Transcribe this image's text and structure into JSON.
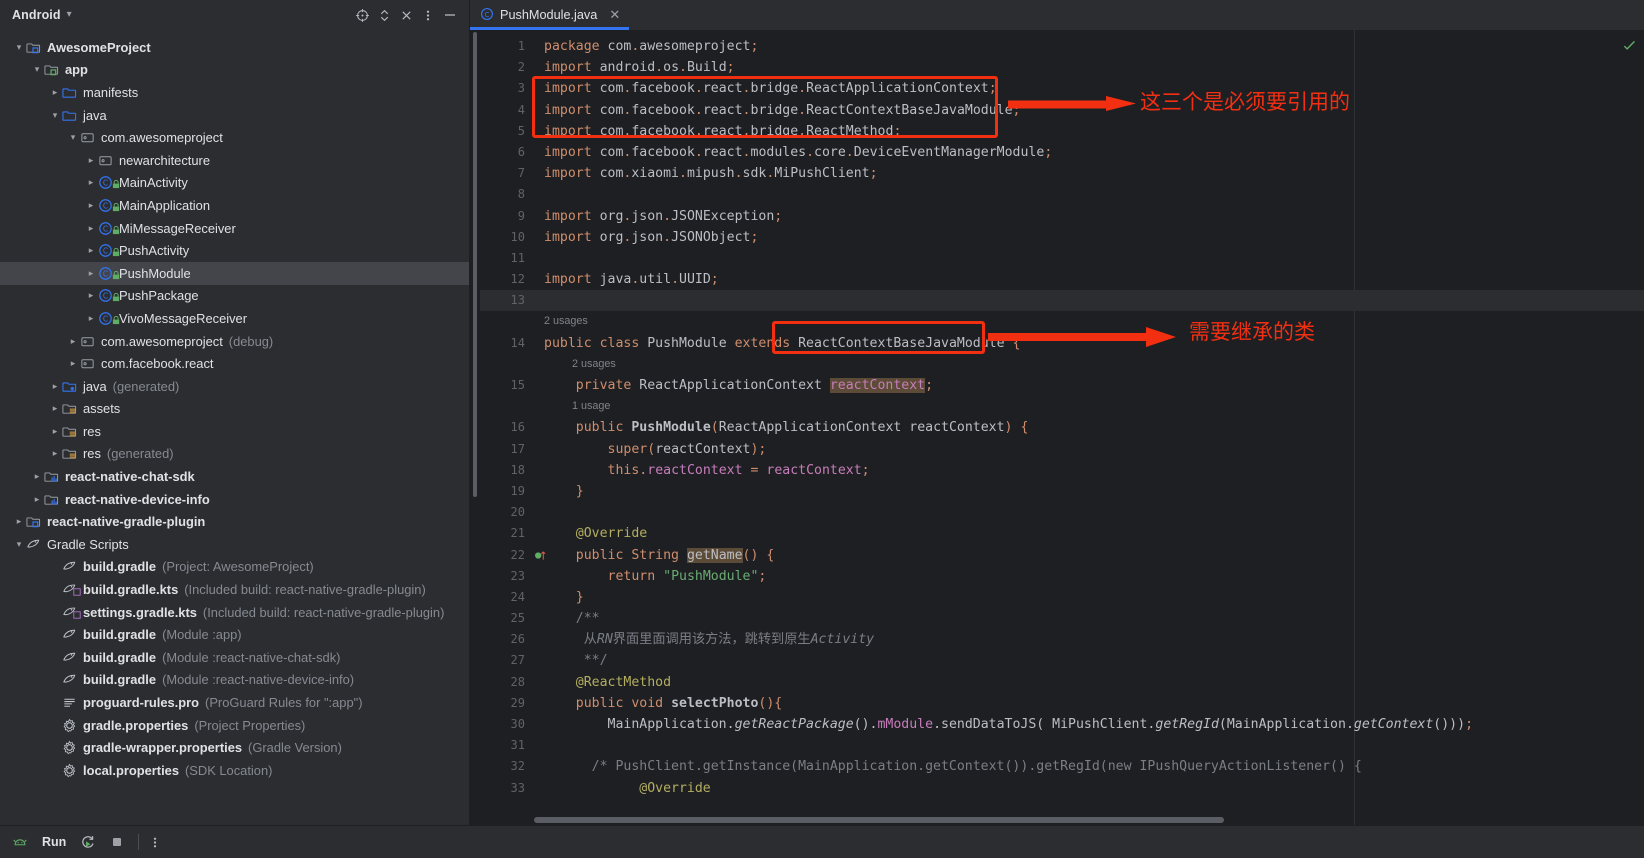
{
  "window": {
    "left_panel_title": "Android",
    "toolbar_icons": [
      "target-icon",
      "expand-collapse-icon",
      "close-icon",
      "more-options-icon",
      "minimize-icon"
    ]
  },
  "tree": [
    {
      "indent": 0,
      "arrow": "down",
      "icon": "module-folder-icon",
      "label": "AwesomeProject",
      "bold": true,
      "sub": ""
    },
    {
      "indent": 1,
      "arrow": "down",
      "icon": "module-folder-green-icon",
      "label": "app",
      "bold": true,
      "sub": ""
    },
    {
      "indent": 2,
      "arrow": "right",
      "icon": "folder-icon",
      "label": "manifests",
      "bold": false,
      "sub": ""
    },
    {
      "indent": 2,
      "arrow": "down",
      "icon": "folder-icon",
      "label": "java",
      "bold": false,
      "sub": ""
    },
    {
      "indent": 3,
      "arrow": "down",
      "icon": "package-icon",
      "label": "com.awesomeproject",
      "bold": false,
      "sub": ""
    },
    {
      "indent": 4,
      "arrow": "right",
      "icon": "package-icon",
      "label": "newarchitecture",
      "bold": false,
      "sub": ""
    },
    {
      "indent": 4,
      "arrow": "right",
      "icon": "java-class-icon",
      "label": "MainActivity",
      "bold": false,
      "sub": ""
    },
    {
      "indent": 4,
      "arrow": "right",
      "icon": "java-class-icon",
      "label": "MainApplication",
      "bold": false,
      "sub": ""
    },
    {
      "indent": 4,
      "arrow": "right",
      "icon": "java-class-icon",
      "label": "MiMessageReceiver",
      "bold": false,
      "sub": ""
    },
    {
      "indent": 4,
      "arrow": "right",
      "icon": "java-class-icon",
      "label": "PushActivity",
      "bold": false,
      "sub": ""
    },
    {
      "indent": 4,
      "arrow": "right",
      "icon": "java-class-icon",
      "label": "PushModule",
      "bold": false,
      "sub": "",
      "selected": true
    },
    {
      "indent": 4,
      "arrow": "right",
      "icon": "java-class-icon",
      "label": "PushPackage",
      "bold": false,
      "sub": ""
    },
    {
      "indent": 4,
      "arrow": "right",
      "icon": "java-class-icon",
      "label": "VivoMessageReceiver",
      "bold": false,
      "sub": ""
    },
    {
      "indent": 3,
      "arrow": "right",
      "icon": "package-icon",
      "label": "com.awesomeproject",
      "bold": false,
      "sub": "(debug)"
    },
    {
      "indent": 3,
      "arrow": "right",
      "icon": "package-icon",
      "label": "com.facebook.react",
      "bold": false,
      "sub": ""
    },
    {
      "indent": 2,
      "arrow": "right",
      "icon": "generated-folder-icon",
      "label": "java",
      "bold": false,
      "sub": "(generated)"
    },
    {
      "indent": 2,
      "arrow": "right",
      "icon": "assets-folder-icon",
      "label": "assets",
      "bold": false,
      "sub": ""
    },
    {
      "indent": 2,
      "arrow": "right",
      "icon": "res-folder-icon",
      "label": "res",
      "bold": false,
      "sub": ""
    },
    {
      "indent": 2,
      "arrow": "right",
      "icon": "res-folder-icon",
      "label": "res",
      "bold": false,
      "sub": "(generated)"
    },
    {
      "indent": 1,
      "arrow": "right",
      "icon": "library-module-icon",
      "label": "react-native-chat-sdk",
      "bold": true,
      "sub": ""
    },
    {
      "indent": 1,
      "arrow": "right",
      "icon": "library-module-icon",
      "label": "react-native-device-info",
      "bold": true,
      "sub": ""
    },
    {
      "indent": 0,
      "arrow": "right",
      "icon": "module-folder-icon",
      "label": "react-native-gradle-plugin",
      "bold": true,
      "sub": ""
    },
    {
      "indent": 0,
      "arrow": "down",
      "icon": "gradle-icon",
      "label": "Gradle Scripts",
      "bold": false,
      "sub": ""
    },
    {
      "indent": 2,
      "arrow": "none",
      "icon": "gradle-file-icon",
      "label": "build.gradle",
      "bold": true,
      "sub": "(Project: AwesomeProject)"
    },
    {
      "indent": 2,
      "arrow": "none",
      "icon": "gradle-kts-file-icon",
      "label": "build.gradle.kts",
      "bold": true,
      "sub": "(Included build: react-native-gradle-plugin)"
    },
    {
      "indent": 2,
      "arrow": "none",
      "icon": "gradle-kts-file-icon",
      "label": "settings.gradle.kts",
      "bold": true,
      "sub": "(Included build: react-native-gradle-plugin)"
    },
    {
      "indent": 2,
      "arrow": "none",
      "icon": "gradle-file-icon",
      "label": "build.gradle",
      "bold": true,
      "sub": "(Module :app)"
    },
    {
      "indent": 2,
      "arrow": "none",
      "icon": "gradle-file-icon",
      "label": "build.gradle",
      "bold": true,
      "sub": "(Module :react-native-chat-sdk)"
    },
    {
      "indent": 2,
      "arrow": "none",
      "icon": "gradle-file-icon",
      "label": "build.gradle",
      "bold": true,
      "sub": "(Module :react-native-device-info)"
    },
    {
      "indent": 2,
      "arrow": "none",
      "icon": "text-file-icon",
      "label": "proguard-rules.pro",
      "bold": true,
      "sub": "(ProGuard Rules for \":app\")"
    },
    {
      "indent": 2,
      "arrow": "none",
      "icon": "properties-file-icon",
      "label": "gradle.properties",
      "bold": true,
      "sub": "(Project Properties)"
    },
    {
      "indent": 2,
      "arrow": "none",
      "icon": "properties-file-icon",
      "label": "gradle-wrapper.properties",
      "bold": true,
      "sub": "(Gradle Version)"
    },
    {
      "indent": 2,
      "arrow": "none",
      "icon": "properties-file-icon",
      "label": "local.properties",
      "bold": true,
      "sub": "(SDK Location)"
    }
  ],
  "editor": {
    "tab_label": "PushModule.java",
    "tab_icon": "java-class-icon",
    "tab_close_icon": "close-icon",
    "inspections_icon": "inspections-ok-icon",
    "line_numbers": [
      "1",
      "2",
      "3",
      "4",
      "5",
      "6",
      "7",
      "8",
      "9",
      "10",
      "11",
      "12",
      "13",
      "14",
      "15",
      "16",
      "17",
      "18",
      "19",
      "20",
      "21",
      "22",
      "23",
      "24",
      "25",
      "26",
      "27",
      "28",
      "29",
      "30",
      "31",
      "32",
      "33"
    ],
    "current_line": 13,
    "gutter_marker_line": 22,
    "gutter_marker_icon": "override-method-icon",
    "inlay_hints": [
      {
        "before_line": 14,
        "text": "2 usages",
        "indent": 0
      },
      {
        "before_line": 15,
        "text": "2 usages",
        "indent": 1
      },
      {
        "before_line": 16,
        "text": "1 usage",
        "indent": 1
      }
    ],
    "lines": [
      "package com.awesomeproject;",
      "import android.os.Build;",
      "import com.facebook.react.bridge.ReactApplicationContext;",
      "import com.facebook.react.bridge.ReactContextBaseJavaModule;",
      "import com.facebook.react.bridge.ReactMethod;",
      "import com.facebook.react.modules.core.DeviceEventManagerModule;",
      "import com.xiaomi.mipush.sdk.MiPushClient;",
      "",
      "import org.json.JSONException;",
      "import org.json.JSONObject;",
      "",
      "import java.util.UUID;",
      "",
      "public class PushModule extends ReactContextBaseJavaModule {",
      "    private ReactApplicationContext reactContext;",
      "    public PushModule(ReactApplicationContext reactContext) {",
      "        super(reactContext);",
      "        this.reactContext = reactContext;",
      "    }",
      "",
      "    @Override",
      "    public String getName() {",
      "        return \"PushModule\";",
      "    }",
      "    /**",
      "     从RN界面里面调用该方法，跳转到原生Activity",
      "     **/",
      "    @ReactMethod",
      "    public void selectPhoto(){",
      "        MainApplication.getReactPackage().mModule.sendDataToJS( MiPushClient.getRegId(MainApplication.getContext()));",
      "",
      "      /* PushClient.getInstance(MainApplication.getContext()).getRegId(new IPushQueryActionListener() {",
      "            @Override"
    ]
  },
  "annotations": [
    {
      "name": "imports-highlight-box",
      "text": "这三个是必须要引用的",
      "color": "#f32f12"
    },
    {
      "name": "superclass-highlight-box",
      "text": "需要继承的类",
      "color": "#f32f12"
    }
  ],
  "bottom_bar": {
    "run_label": "Run",
    "icons": [
      "android-robot-icon",
      "rerun-icon",
      "stop-icon",
      "more-options-icon"
    ]
  }
}
